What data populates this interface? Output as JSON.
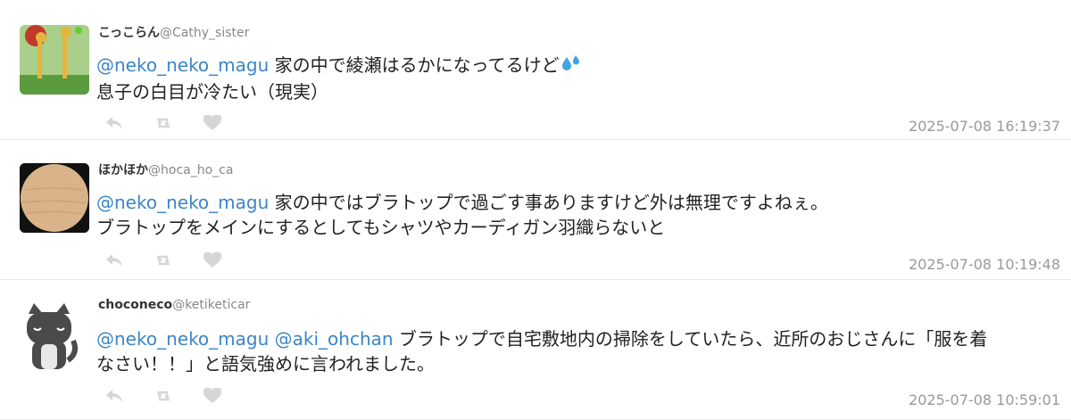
{
  "tweets": [
    {
      "display_name": "こっこらん",
      "handle": "@Cathy_sister",
      "mentions": "@neko_neko_magu",
      "line1": " 家の中で綾瀬はるかになってるけど",
      "line2": "息子の白目が冷たい（現実）",
      "timestamp": "2025-07-08 16:19:37",
      "avatar_icon": "giraffe-painting-icon"
    },
    {
      "display_name": "ほかほか",
      "handle": "@hoca_ho_ca",
      "mentions": "@neko_neko_magu",
      "line1": " 家の中ではブラトップで過ごす事ありますけど外は無理ですよねぇ。",
      "line2": "ブラトップをメインにするとしてもシャツやカーディガン羽織らないと",
      "timestamp": "2025-07-08 10:19:48",
      "avatar_icon": "wood-circle-icon"
    },
    {
      "display_name": "choconeco",
      "handle": "@ketiketicar",
      "mentions": "@neko_neko_magu @aki_ohchan",
      "line1": " ブラトップで自宅敷地内の掃除をしていたら、近所のおじさんに「服を着",
      "line2": "なさい！！」と語気強めに言われました。",
      "timestamp": "2025-07-08 10:59:01",
      "avatar_icon": "cat-icon"
    }
  ],
  "colors": {
    "mention": "#3b86c6",
    "icon": "#d6d6d6",
    "timestamp": "#999999"
  }
}
